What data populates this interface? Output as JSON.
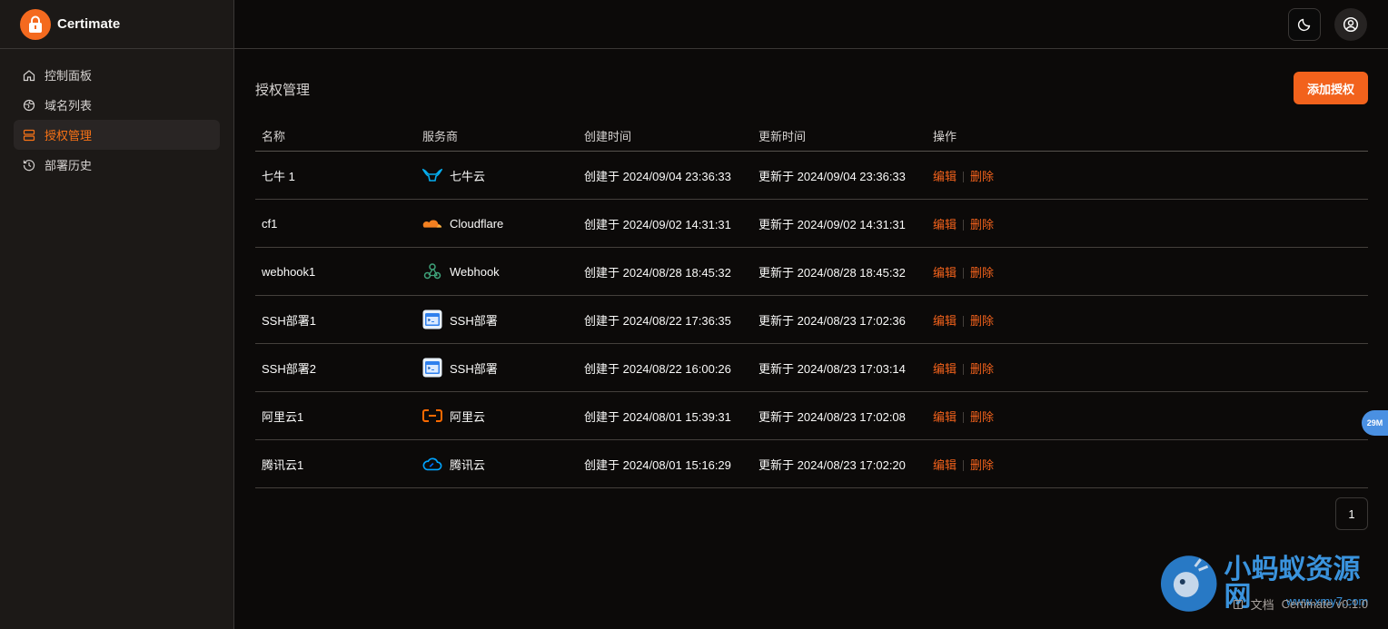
{
  "app": {
    "name": "Certimate",
    "version": "Certimate v0.1.0"
  },
  "sidebar": {
    "items": [
      {
        "label": "控制面板",
        "icon": "home-icon",
        "active": false
      },
      {
        "label": "域名列表",
        "icon": "globe-icon",
        "active": false
      },
      {
        "label": "授权管理",
        "icon": "server-icon",
        "active": true
      },
      {
        "label": "部署历史",
        "icon": "history-icon",
        "active": false
      }
    ]
  },
  "header": {
    "theme_icon": "moon-icon",
    "user_icon": "user-circle-icon"
  },
  "page": {
    "title": "授权管理",
    "add_label": "添加授权"
  },
  "table": {
    "columns": [
      "名称",
      "服务商",
      "创建时间",
      "更新时间",
      "操作"
    ],
    "rows": [
      {
        "name": "七牛 1",
        "provider": "七牛云",
        "provider_icon": "qiniu-icon",
        "created": "创建于 2024/09/04 23:36:33",
        "updated": "更新于 2024/09/04 23:36:33"
      },
      {
        "name": "cf1",
        "provider": "Cloudflare",
        "provider_icon": "cloudflare-icon",
        "created": "创建于 2024/09/02 14:31:31",
        "updated": "更新于 2024/09/02 14:31:31"
      },
      {
        "name": "webhook1",
        "provider": "Webhook",
        "provider_icon": "webhook-icon",
        "created": "创建于 2024/08/28 18:45:32",
        "updated": "更新于 2024/08/28 18:45:32"
      },
      {
        "name": "SSH部署1",
        "provider": "SSH部署",
        "provider_icon": "ssh-icon",
        "created": "创建于 2024/08/22 17:36:35",
        "updated": "更新于 2024/08/23 17:02:36"
      },
      {
        "name": "SSH部署2",
        "provider": "SSH部署",
        "provider_icon": "ssh-icon",
        "created": "创建于 2024/08/22 16:00:26",
        "updated": "更新于 2024/08/23 17:03:14"
      },
      {
        "name": "阿里云1",
        "provider": "阿里云",
        "provider_icon": "aliyun-icon",
        "created": "创建于 2024/08/01 15:39:31",
        "updated": "更新于 2024/08/23 17:02:08"
      },
      {
        "name": "腾讯云1",
        "provider": "腾讯云",
        "provider_icon": "tencent-cloud-icon",
        "created": "创建于 2024/08/01 15:16:29",
        "updated": "更新于 2024/08/23 17:02:20"
      }
    ],
    "edit_label": "编辑",
    "delete_label": "删除"
  },
  "pagination": {
    "current": "1"
  },
  "footer": {
    "docs_label": "文档"
  },
  "float_badge": "29M",
  "watermark": {
    "text": "小蚂蚁资源网",
    "url": "www.xmy7.com"
  },
  "colors": {
    "accent": "#f2621c",
    "background": "#0c0a09",
    "sidebar": "#1c1917"
  }
}
